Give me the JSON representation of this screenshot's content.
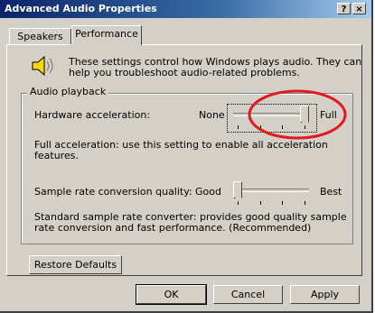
{
  "window": {
    "title": "Advanced Audio Properties",
    "help_label": "?",
    "close_label": "×"
  },
  "tabs": [
    {
      "label": "Speakers"
    },
    {
      "label": "Performance"
    }
  ],
  "performance": {
    "description_line1": "These settings control how Windows plays audio. They can",
    "description_line2": "help you troubleshoot audio-related problems.",
    "group_label": "Audio playback",
    "hw_accel": {
      "label": "Hardware acceleration:",
      "min_label": "None",
      "max_label": "Full",
      "level": 1.0,
      "info_line1": "Full acceleration: use this setting to enable all acceleration",
      "info_line2": "features."
    },
    "sample_rate": {
      "label": "Sample rate conversion quality:",
      "min_label": "Good",
      "max_label": "Best",
      "level": 0.0,
      "info_line1": "Standard sample rate converter:  provides good quality sample",
      "info_line2": "rate conversion and fast performance. (Recommended)"
    },
    "restore_defaults_label": "Restore Defaults"
  },
  "buttons": {
    "ok": "OK",
    "cancel": "Cancel",
    "apply": "Apply"
  },
  "colors": {
    "annotation_circle": "#e0191e",
    "titlebar": "#0a246a",
    "face": "#d4d0c8"
  }
}
